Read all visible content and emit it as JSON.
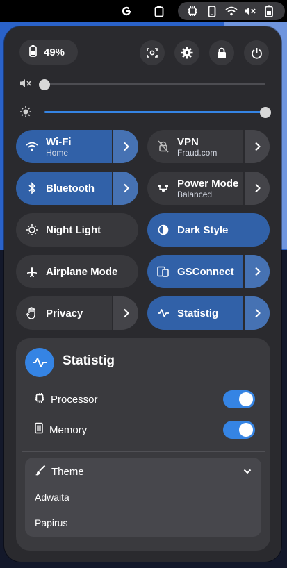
{
  "battery": {
    "percent_label": "49%"
  },
  "tiles": {
    "wifi": {
      "title": "Wi-Fi",
      "subtitle": "Home"
    },
    "vpn": {
      "title": "VPN",
      "subtitle": "Fraud.com"
    },
    "bluetooth": {
      "title": "Bluetooth"
    },
    "power_mode": {
      "title": "Power Mode",
      "subtitle": "Balanced"
    },
    "night_light": {
      "title": "Night Light"
    },
    "dark_style": {
      "title": "Dark Style"
    },
    "airplane": {
      "title": "Airplane Mode"
    },
    "gsconnect": {
      "title": "GSConnect"
    },
    "privacy": {
      "title": "Privacy"
    },
    "statistig": {
      "title": "Statistig"
    }
  },
  "sliders": {
    "volume_level": 0.0,
    "brightness_level": 1.0
  },
  "submenu": {
    "title": "Statistig",
    "processor_label": "Processor",
    "processor_on": true,
    "memory_label": "Memory",
    "memory_on": true,
    "theme_label": "Theme",
    "theme_options": [
      "Adwaita",
      "Papirus"
    ]
  },
  "colors": {
    "accent": "#3584e4",
    "tile_on": "#3161a8",
    "panel": "#2a2a2e"
  }
}
